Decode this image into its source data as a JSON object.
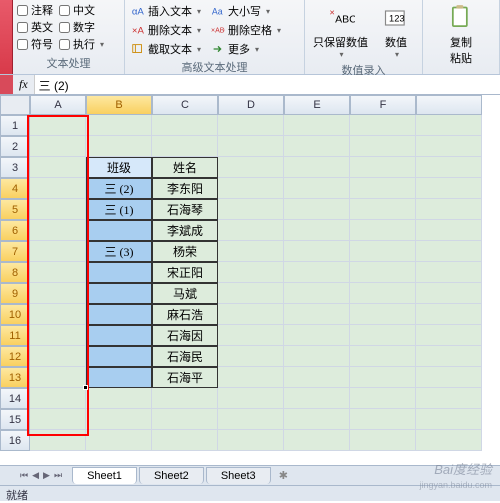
{
  "ribbon": {
    "group1": {
      "label": "文本处理",
      "checks": [
        "注释",
        "英文",
        "符号",
        "中文",
        "数字",
        "执行"
      ]
    },
    "group2": {
      "label": "高级文本处理",
      "items": [
        "插入文本",
        "删除文本",
        "截取文本",
        "大小写",
        "删除空格",
        "更多"
      ]
    },
    "group3": {
      "label": "数值录入",
      "btns": [
        "只保留数值",
        "数值"
      ]
    },
    "group4": {
      "btn": "复制\n粘贴"
    }
  },
  "fbar": {
    "fx": "fx",
    "value": "三 (2)"
  },
  "cols": [
    "A",
    "B",
    "C",
    "D",
    "E",
    "F"
  ],
  "rows": 16,
  "table": {
    "headers": [
      "班级",
      "姓名"
    ],
    "classes": [
      "三 (2)",
      "三 (1)",
      "",
      "三 (3)",
      "",
      "",
      "",
      "",
      "",
      ""
    ],
    "names": [
      "李东阳",
      "石海琴",
      "李斌成",
      "杨荣",
      "宋正阳",
      "马斌",
      "麻石浩",
      "石海因",
      "石海民",
      "石海平"
    ]
  },
  "tabs": [
    "Sheet1",
    "Sheet2",
    "Sheet3"
  ],
  "status": "就绪",
  "watermark": {
    "main": "Bai度经验",
    "sub": "jingyan.baidu.com"
  }
}
